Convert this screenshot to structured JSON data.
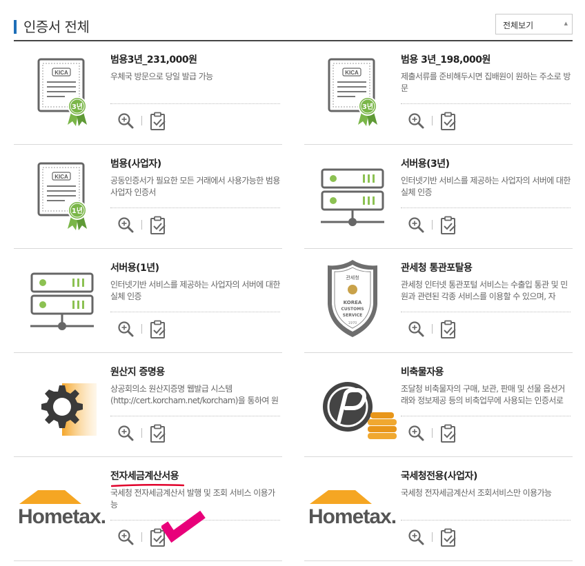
{
  "header": {
    "title": "인증서 전체",
    "view_select": "전체보기"
  },
  "cards": [
    {
      "name": "범용3년_231,000원",
      "desc": "우체국 방문으로 당일 발급 가능",
      "icon": "kica-certificate-3yr-icon",
      "badge": "3년",
      "logo": "KICA"
    },
    {
      "name": "범용 3년_198,000원",
      "desc": "제출서류를 준비해두시면 집배원이 원하는 주소로 방문",
      "icon": "kica-certificate-3yr-icon",
      "badge": "3년",
      "logo": "KICA"
    },
    {
      "name": "범용(사업자)",
      "desc": "공동인증서가 필요한 모든 거래에서 사용가능한 범용사업자 인증서",
      "icon": "kica-certificate-1yr-icon",
      "badge": "1년",
      "logo": "KICA"
    },
    {
      "name": "서버용(3년)",
      "desc": "인터넷기반 서비스를 제공하는 사업자의 서버에 대한 실체 인증",
      "icon": "server-icon"
    },
    {
      "name": "서버용(1년)",
      "desc": "인터넷기반 서비스를 제공하는 사업자의 서버에 대한 실체 인증",
      "icon": "server-icon"
    },
    {
      "name": "관세청 통관포탈용",
      "desc": "관세청 인터넷 통관포털 서비스는 수출입 통관 및 민원과 관련된 각종 서비스를 이용할 수 있으며, 자",
      "icon": "korea-customs-emblem-icon",
      "emblem": {
        "top": "관세청",
        "line1": "KOREA",
        "line2": "CUSTOMS",
        "line3": "SERVICE",
        "year": "1970"
      }
    },
    {
      "name": "원산지 증명용",
      "desc": "상공회의소 원산지증명 웹발급 시스템(http://cert.korcham.net/korcham)을 통하여 원산지증",
      "icon": "gear-icon"
    },
    {
      "name": "비축물자용",
      "desc": "조달청 비축물자의 구매, 보관, 판매 및 선물 옵션거래와 정보제공 등의 비축업무에 사용되는 인증서로",
      "icon": "procurement-coin-icon"
    },
    {
      "name": "전자세금계산서용",
      "desc": "국세청 전자세금계산서 발행 및 조회 서비스 이용가능",
      "icon": "hometax-logo",
      "logo": "Hometax."
    },
    {
      "name": "국세청전용(사업자)",
      "desc": "국세청 전자세금계산서 조회서비스만 이용가능",
      "icon": "hometax-logo",
      "logo": "Hometax."
    }
  ],
  "colors": {
    "accent": "#1e6fb8",
    "badge_green": "#7ab648",
    "server_green": "#8cc152",
    "hometax_orange": "#f5a623",
    "annotation_red": "#e0002a",
    "annotation_magenta": "#e8007a"
  }
}
